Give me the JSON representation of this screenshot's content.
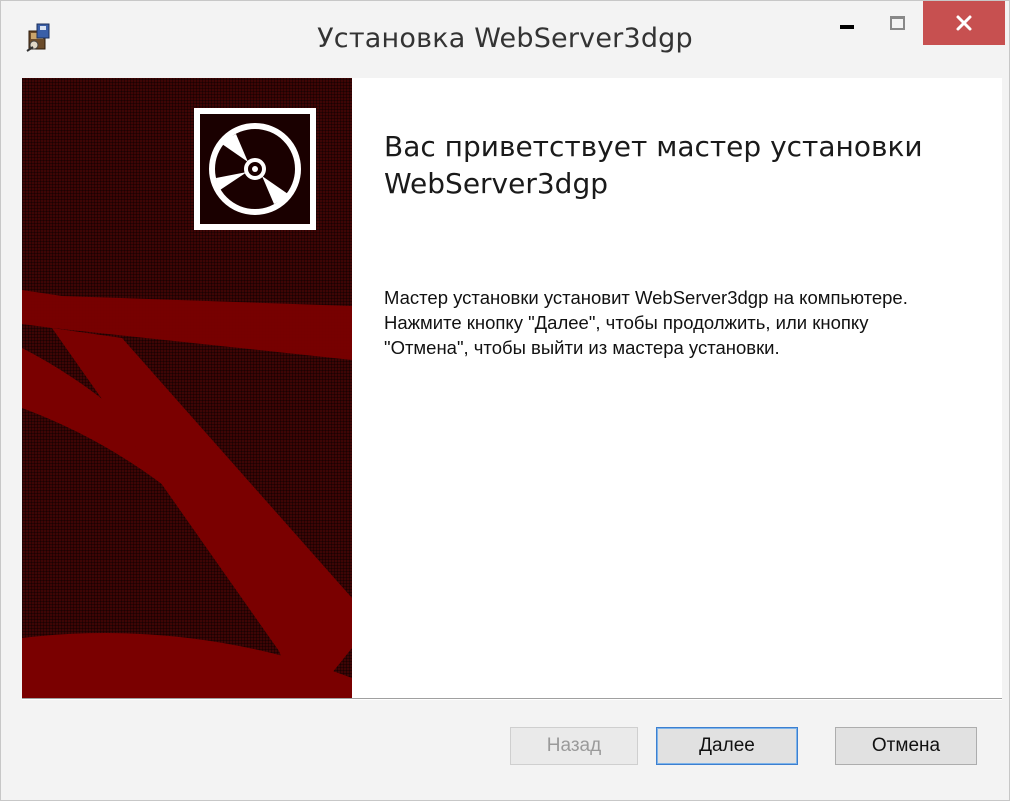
{
  "window": {
    "title": "Установка WebServer3dgp",
    "icon": "installer-icon",
    "controls": [
      "minimize-icon",
      "maximize-icon",
      "close-icon"
    ],
    "close_color": "#c75050"
  },
  "banner": {
    "background_color": "#3e0505",
    "shape_color": "#7a0000",
    "icon": "disc-icon"
  },
  "welcome": {
    "heading": "Вас приветствует мастер установки\nWebServer3dgp",
    "description": "Мастер установки установит WebServer3dgp на компьютере. Нажмите кнопку \"Далее\", чтобы продолжить, или кнопку \"Отмена\", чтобы выйти из мастера установки."
  },
  "buttons": {
    "back_label": "Назад",
    "back_enabled": false,
    "next_label": "Далее",
    "cancel_label": "Отмена"
  }
}
